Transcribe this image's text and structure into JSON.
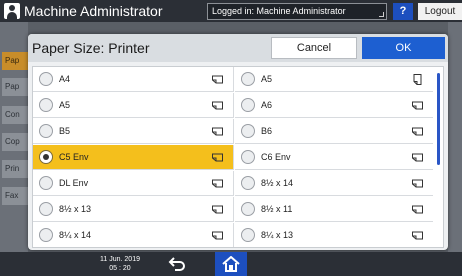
{
  "topbar": {
    "title": "Machine Administrator",
    "login_status": "Logged in: Machine Administrator",
    "help_label": "?",
    "logout_label": "Logout"
  },
  "background": {
    "left_items": [
      "Pap",
      "Pap",
      "Con",
      "Cop",
      "Prin",
      "Fax"
    ]
  },
  "dialog": {
    "title": "Paper Size: Printer",
    "cancel_label": "Cancel",
    "ok_label": "OK",
    "options": [
      {
        "label": "A4",
        "selected": false,
        "orientation": "landscape"
      },
      {
        "label": "A5",
        "selected": false,
        "orientation": "portrait"
      },
      {
        "label": "A5",
        "selected": false,
        "orientation": "landscape"
      },
      {
        "label": "A6",
        "selected": false,
        "orientation": "landscape"
      },
      {
        "label": "B5",
        "selected": false,
        "orientation": "landscape"
      },
      {
        "label": "B6",
        "selected": false,
        "orientation": "landscape"
      },
      {
        "label": "C5 Env",
        "selected": true,
        "orientation": "landscape"
      },
      {
        "label": "C6 Env",
        "selected": false,
        "orientation": "landscape"
      },
      {
        "label": "DL Env",
        "selected": false,
        "orientation": "landscape"
      },
      {
        "label": "8½ x 14",
        "selected": false,
        "orientation": "landscape"
      },
      {
        "label": "8½ x 13",
        "selected": false,
        "orientation": "landscape"
      },
      {
        "label": "8½ x 11",
        "selected": false,
        "orientation": "landscape"
      },
      {
        "label": "8¼ x 14",
        "selected": false,
        "orientation": "landscape"
      },
      {
        "label": "8¼ x 13",
        "selected": false,
        "orientation": "landscape"
      }
    ]
  },
  "bottombar": {
    "date": "11 Jun. 2019",
    "time": "05 : 20"
  },
  "colors": {
    "selected": "#f4bf1c",
    "accent": "#1d5fd1",
    "bar": "#2b2f36"
  }
}
